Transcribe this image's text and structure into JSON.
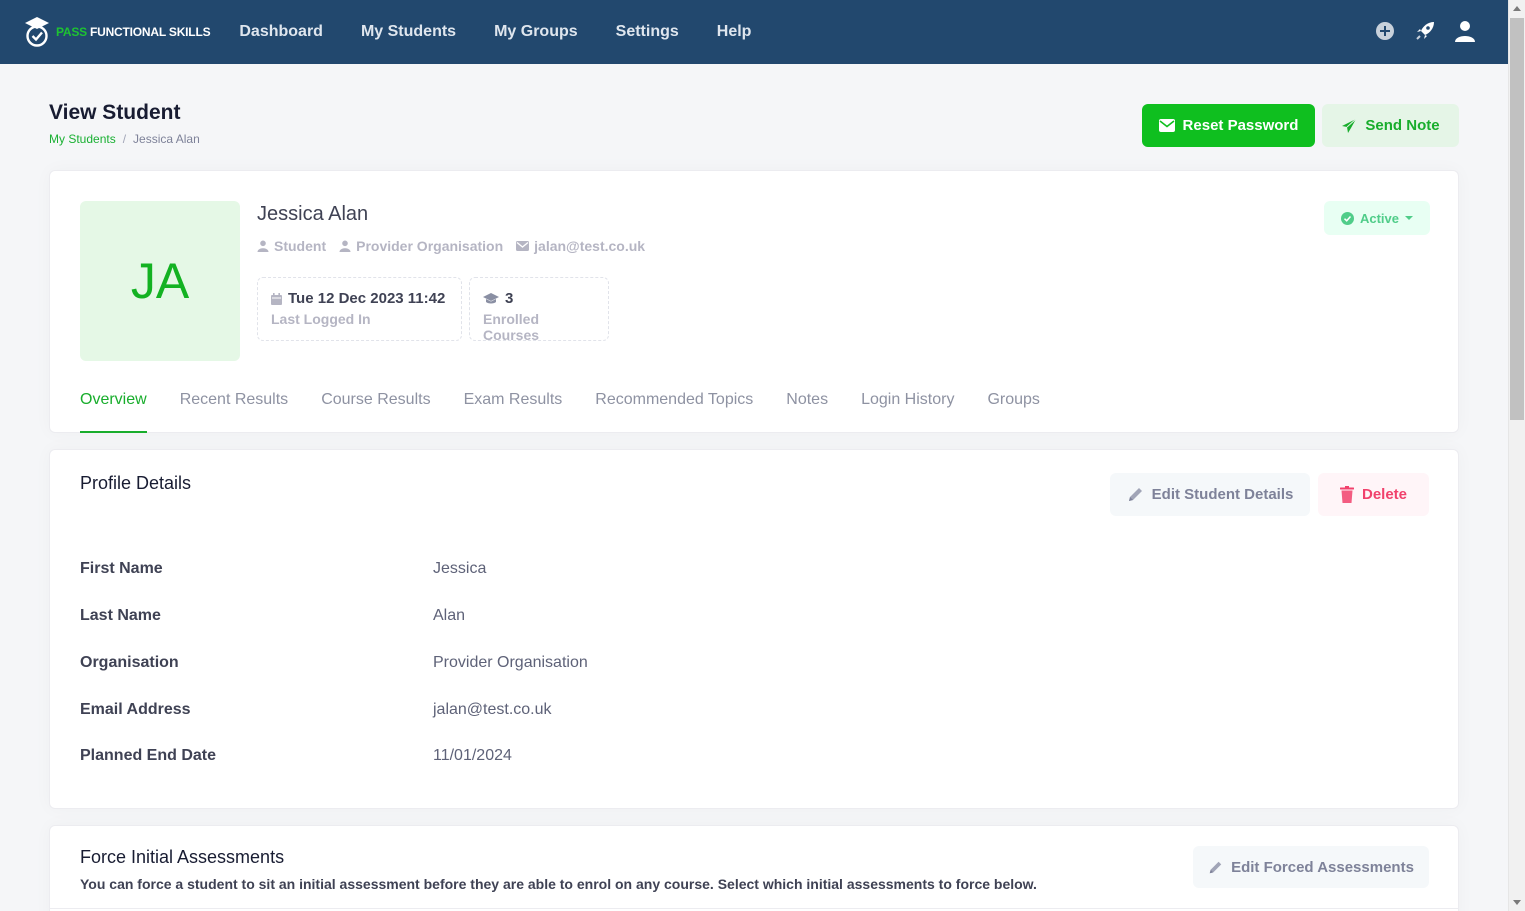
{
  "brand": {
    "pass": "PASS",
    "rest": "FUNCTIONAL SKILLS"
  },
  "nav": [
    "Dashboard",
    "My Students",
    "My Groups",
    "Settings",
    "Help"
  ],
  "page": {
    "title": "View Student",
    "breadcrumb": {
      "link": "My Students",
      "separator": "/",
      "current": "Jessica Alan"
    },
    "reset_password": "Reset Password",
    "send_note": "Send Note"
  },
  "student": {
    "initials": "JA",
    "name": "Jessica Alan",
    "role": "Student",
    "organisation": "Provider Organisation",
    "email": "jalan@test.co.uk",
    "status": "Active",
    "last_logged_in": {
      "value": "Tue 12 Dec 2023 11:42",
      "label": "Last Logged In"
    },
    "enrolled": {
      "value": "3",
      "label": "Enrolled Courses"
    }
  },
  "tabs": [
    "Overview",
    "Recent Results",
    "Course Results",
    "Exam Results",
    "Recommended Topics",
    "Notes",
    "Login History",
    "Groups"
  ],
  "profile": {
    "title": "Profile Details",
    "edit_label": "Edit Student Details",
    "delete_label": "Delete",
    "rows": [
      {
        "label": "First Name",
        "value": "Jessica"
      },
      {
        "label": "Last Name",
        "value": "Alan"
      },
      {
        "label": "Organisation",
        "value": "Provider Organisation"
      },
      {
        "label": "Email Address",
        "value": "jalan@test.co.uk"
      },
      {
        "label": "Planned End Date",
        "value": "11/01/2024"
      }
    ]
  },
  "force": {
    "title": "Force Initial Assessments",
    "description": "You can force a student to sit an initial assessment before they are able to enrol on any course. Select which initial assessments to force below.",
    "edit_label": "Edit Forced Assessments"
  },
  "colors": {
    "navbar": "#22486e",
    "brand_green": "#0fbf1f",
    "active_tab": "#18ad2c",
    "danger": "#f1416c"
  }
}
